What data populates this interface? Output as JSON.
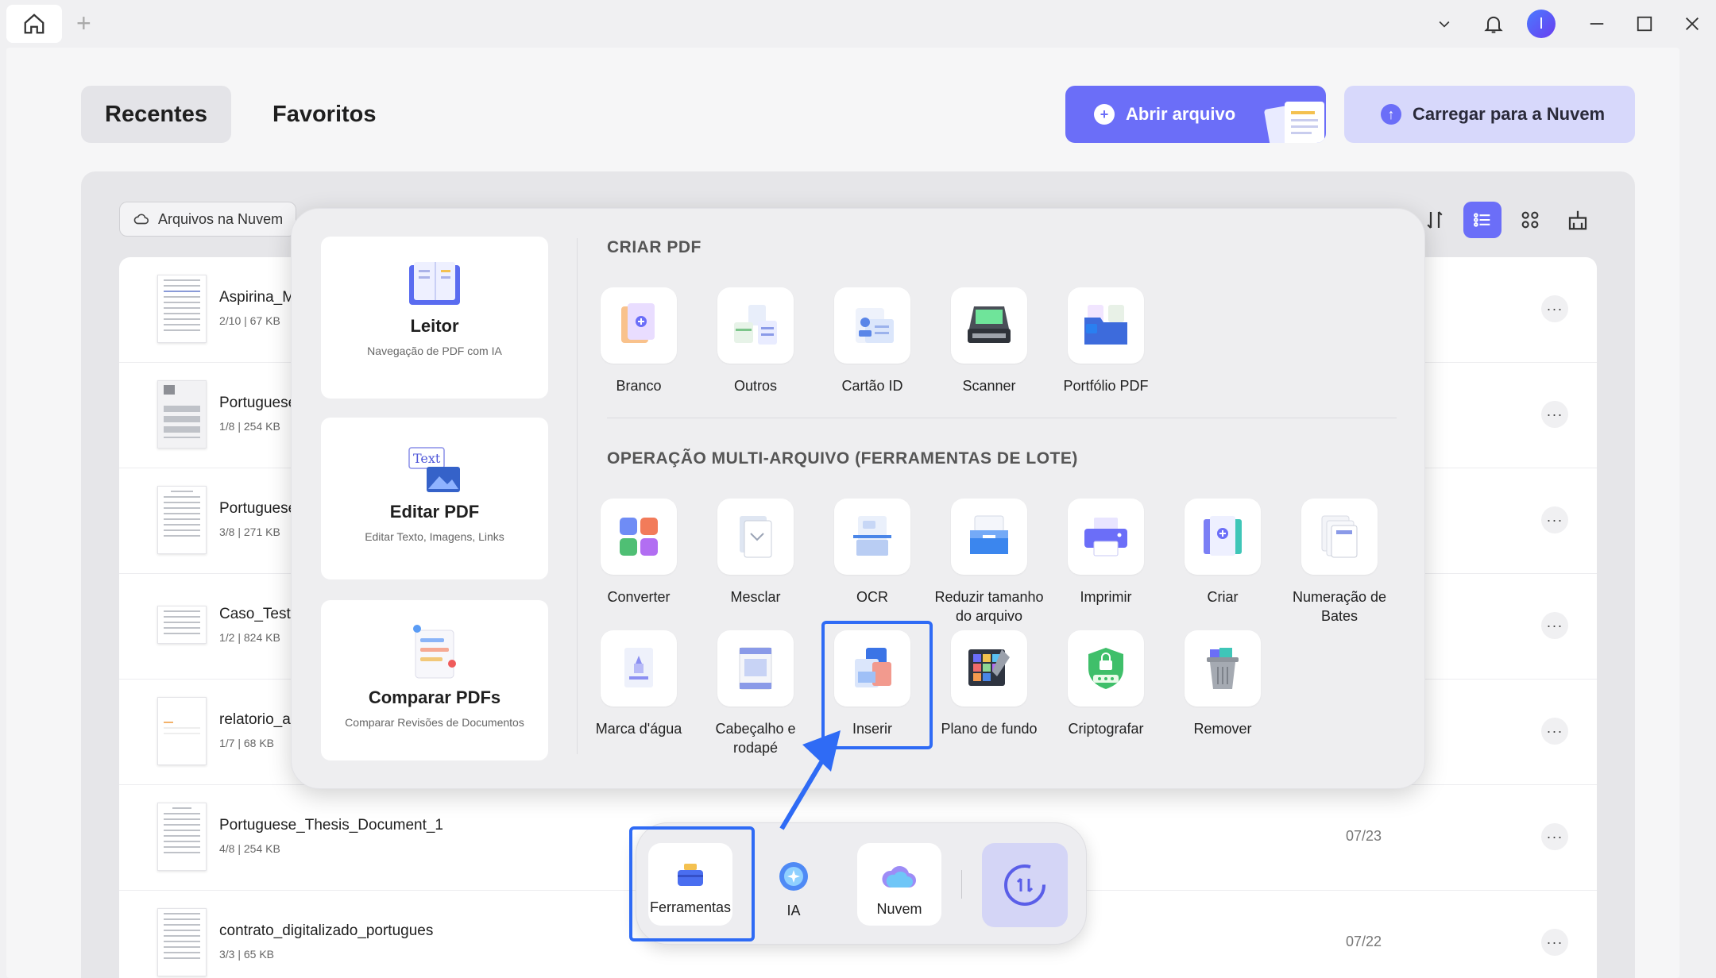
{
  "colors": {
    "accent": "#6b6ef8",
    "highlight": "#2f6bf5",
    "accent_light": "#d7d8fb"
  },
  "titlebar": {
    "icons": [
      "home-icon",
      "plus-icon",
      "chevron-down-icon",
      "bell-icon",
      "minimize-icon",
      "maximize-icon",
      "close-icon"
    ],
    "avatar_initial": "I"
  },
  "tabs": {
    "recent": "Recentes",
    "favorites": "Favoritos"
  },
  "actions": {
    "open_file": "Abrir arquivo",
    "upload_cloud": "Carregar para a Nuvem"
  },
  "filter": {
    "cloud_files": "Arquivos na Nuvem"
  },
  "files": [
    {
      "name": "Aspirina_M",
      "meta": "2/10 | 67 KB",
      "date": ""
    },
    {
      "name": "Portuguese",
      "meta": "1/8 | 254 KB",
      "date": ""
    },
    {
      "name": "Portuguese",
      "meta": "3/8 | 271 KB",
      "date": ""
    },
    {
      "name": "Caso_Teste_",
      "meta": "1/2 | 824 KB",
      "date": ""
    },
    {
      "name": "relatorio_au",
      "meta": "1/7 | 68 KB",
      "date": ""
    },
    {
      "name": "Portuguese_Thesis_Document_1",
      "meta": "4/8 | 254 KB",
      "date": "07/23"
    },
    {
      "name": "contrato_digitalizado_portugues",
      "meta": "3/3 | 65 KB",
      "date": "07/22"
    }
  ],
  "more_label": "···",
  "popup": {
    "cards": [
      {
        "title": "Leitor",
        "subtitle": "Navegação de PDF com IA"
      },
      {
        "title": "Editar PDF",
        "subtitle": "Editar Texto, Imagens, Links",
        "icon_text": "Text"
      },
      {
        "title": "Comparar PDFs",
        "subtitle": "Comparar Revisões de Documentos"
      }
    ],
    "create_title": "CRIAR PDF",
    "create_tools": [
      {
        "label": "Branco"
      },
      {
        "label": "Outros"
      },
      {
        "label": "Cartão ID"
      },
      {
        "label": "Scanner"
      },
      {
        "label": "Portfólio PDF"
      }
    ],
    "batch_title": "OPERAÇÃO MULTI-ARQUIVO (FERRAMENTAS DE LOTE)",
    "batch_row1": [
      {
        "label": "Converter"
      },
      {
        "label": "Mesclar"
      },
      {
        "label": "OCR"
      },
      {
        "label": "Reduzir tamanho do arquivo"
      },
      {
        "label": "Imprimir"
      },
      {
        "label": "Criar"
      },
      {
        "label": "Numeração de Bates"
      }
    ],
    "batch_row2": [
      {
        "label": "Marca d'água"
      },
      {
        "label": "Cabeçalho e rodapé"
      },
      {
        "label": "Inserir"
      },
      {
        "label": "Plano de fundo"
      },
      {
        "label": "Criptografar"
      },
      {
        "label": "Remover"
      }
    ]
  },
  "dock": {
    "tools": "Ferramentas",
    "ai": "IA",
    "cloud": "Nuvem"
  }
}
